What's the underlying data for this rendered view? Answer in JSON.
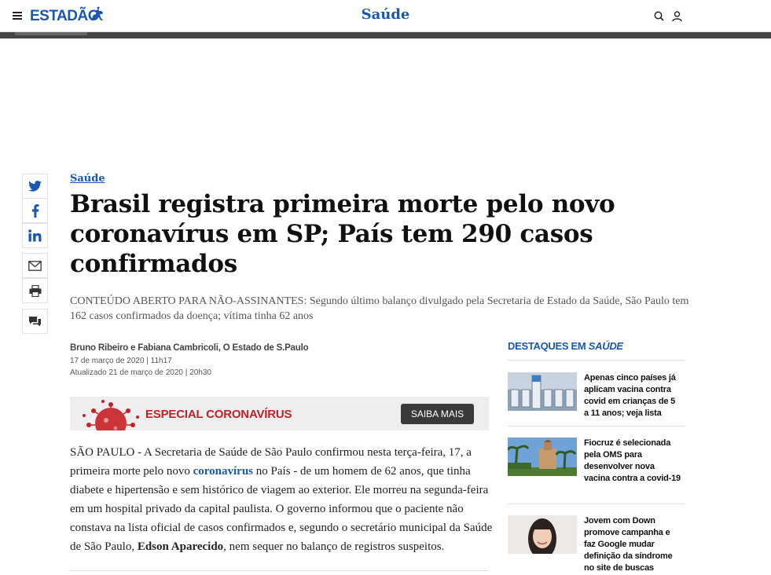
{
  "header": {
    "logo_text": "ESTADÃO",
    "section": "Saúde",
    "icons": [
      "menu-icon",
      "search-icon",
      "user-icon"
    ]
  },
  "share": {
    "icons": [
      "twitter-icon",
      "facebook-icon",
      "linkedin-icon",
      "email-icon",
      "print-icon",
      "comments-icon"
    ]
  },
  "article": {
    "kicker": "Saúde",
    "headline": "Brasil registra primeira morte pelo novo coronavírus em SP; País tem 290 casos confirmados",
    "subtitle": "CONTEÚDO ABERTO PARA NÃO-ASSINANTES: Segundo último balanço divulgado pela Secretaria de Estado da Saúde, São Paulo tem 162 casos confirmados da doença; vítima tinha 62 anos",
    "byline": "Bruno Ribeiro e Fabiana Cambricoli, O Estado de S.Paulo",
    "published": "17 de março de 2020 | 11h17",
    "updated": "Atualizado 21 de março de 2020 | 20h30",
    "body_part1": "SÃO PAULO - A Secretaria de Saúde de São Paulo confirmou nesta terça-feira, 17, a primeira morte pelo novo ",
    "body_link": "coronavírus",
    "body_part2": " no País - de um homem de 62 anos, que tinha diabete e hipertensão e sem histórico de viagem ao exterior. Ele morreu na segunda-feira em um hospital privado da capital paulista. O governo informou que o paciente não constava na lista oficial de casos confirmados e, segundo o secretário municipal da Saúde de São Paulo, ",
    "body_bold": "Edson Aparecido",
    "body_part3": ", nem sequer no balanço de registros suspeitos."
  },
  "banner": {
    "title": "ESPECIAL CORONAVÍRUS",
    "button": "SAIBA MAIS",
    "accent": "#c71f25"
  },
  "sidebar": {
    "heading_prefix": "DESTAQUES EM ",
    "heading_section": "SAÚDE",
    "items": [
      {
        "title": "Apenas cinco países já aplicam vacina contra covid em crianças de 5 a 11 anos; veja lista"
      },
      {
        "title": "Fiocruz é selecionada pela OMS para desenvolver nova vacina contra a covid-19"
      },
      {
        "title": "Jovem com Down promove campanha e faz Google mudar definição da síndrome no site de buscas"
      }
    ]
  },
  "colors": {
    "brand": "#1a56b3",
    "text": "#222222"
  }
}
